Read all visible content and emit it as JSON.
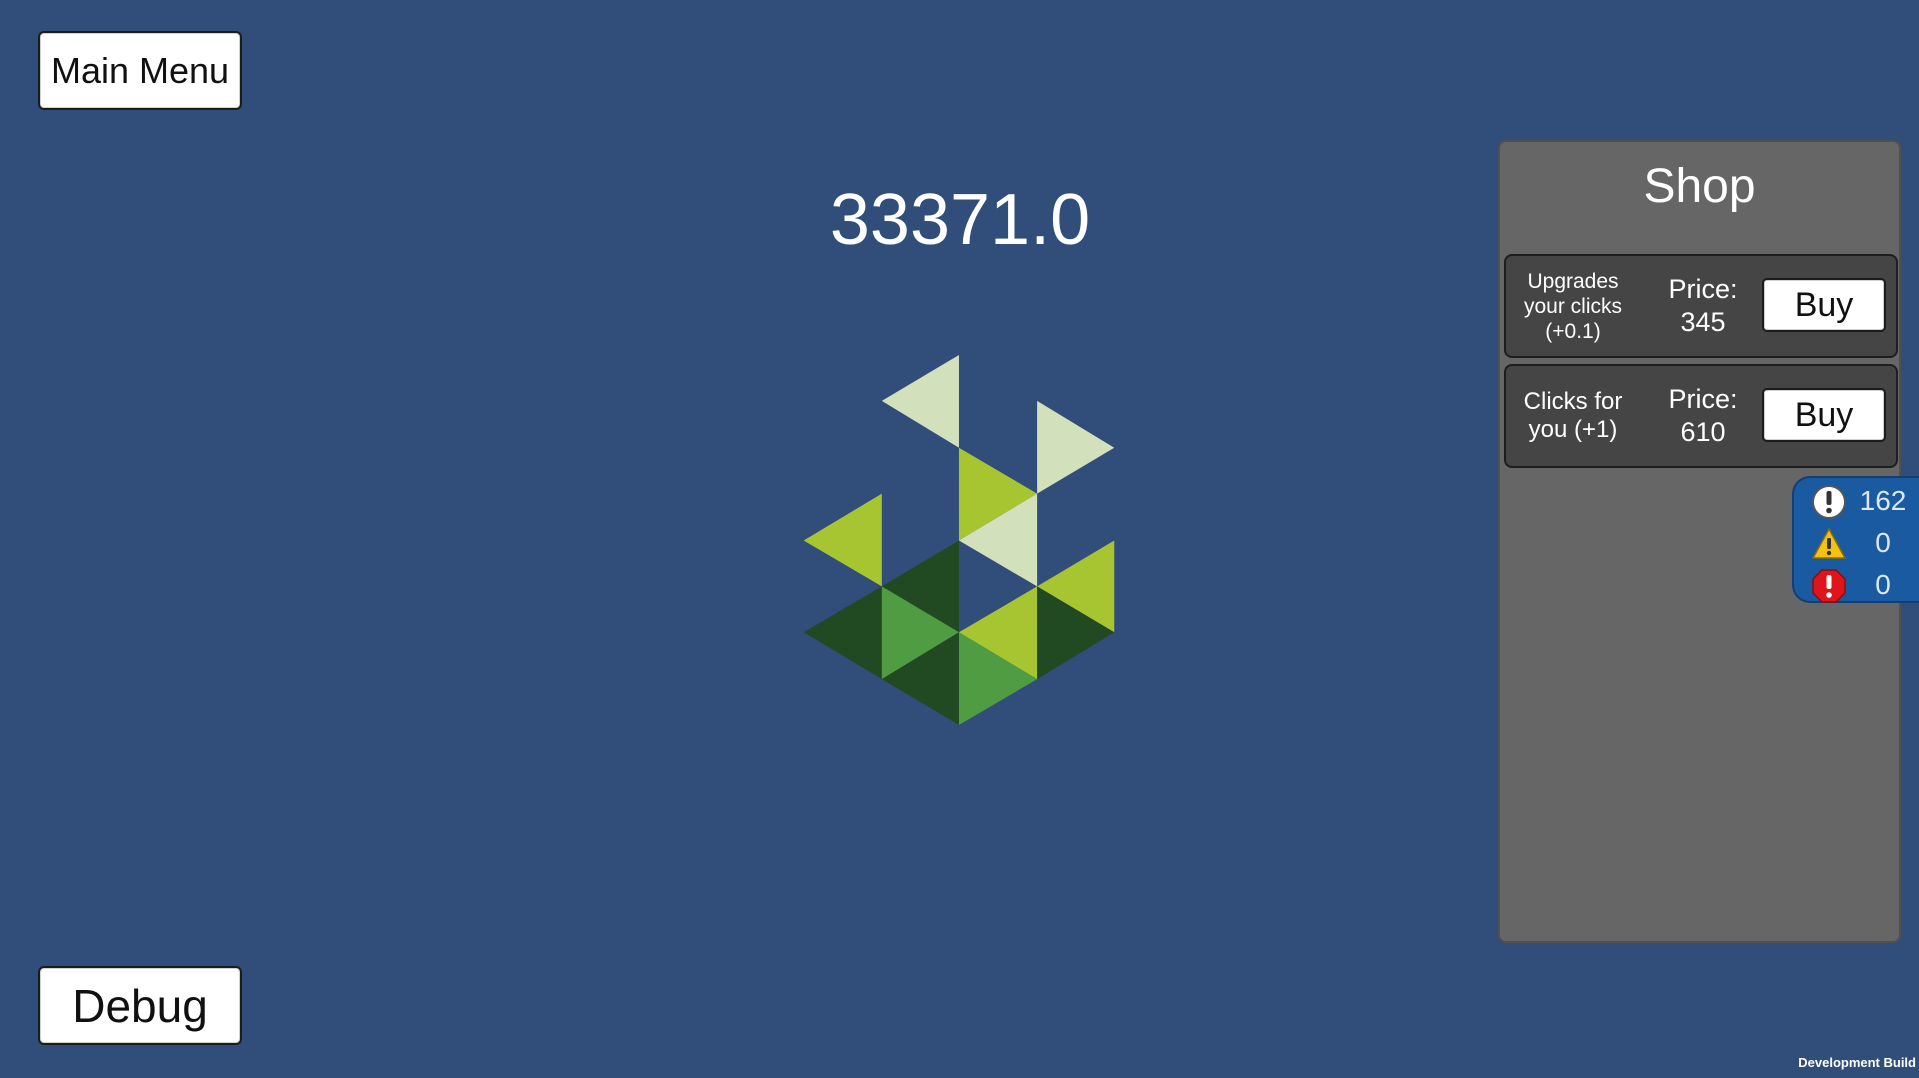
{
  "main_menu_label": "Main Menu",
  "debug_label": "Debug",
  "score": "33371.0",
  "shop": {
    "title": "Shop",
    "items": [
      {
        "description": "Upgrades your clicks (+0.1)",
        "price_label": "Price:",
        "price": "345",
        "buy_label": "Buy"
      },
      {
        "description": "Clicks for you (+1)",
        "price_label": "Price:",
        "price": "610",
        "buy_label": "Buy"
      }
    ]
  },
  "console_counter": {
    "info": "162",
    "warnings": "0",
    "errors": "0"
  },
  "dev_build_label": "Development Build",
  "colors": {
    "background": "#314d79",
    "shop_panel": "#666666",
    "shop_item": "#454545",
    "console_badge": "#1a5aa0",
    "logo_light": "#d3e0bc",
    "logo_lime": "#a7c530",
    "logo_mid": "#4f9c42",
    "logo_dark": "#214a22"
  },
  "icons": {
    "click_target": "triangle-logo",
    "console_info": "info-icon",
    "console_warning": "warning-icon",
    "console_error": "error-icon"
  }
}
